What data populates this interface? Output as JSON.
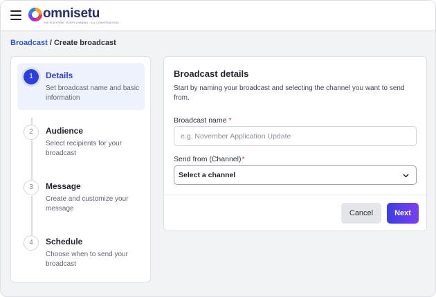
{
  "header": {
    "logo_text": "omnisetu",
    "logo_tagline": "THE PLATFORM · EVERY CHANNEL · ALL CONVERSATIONS"
  },
  "breadcrumb": {
    "parent": "Broadcast",
    "separator": " / ",
    "current": "Create broadcast"
  },
  "steps": [
    {
      "number": "1",
      "title": "Details",
      "description": "Set broadcast name and basic information",
      "active": true
    },
    {
      "number": "2",
      "title": "Audience",
      "description": "Select recipients for your broadcast",
      "active": false
    },
    {
      "number": "3",
      "title": "Message",
      "description": "Create and customize your message",
      "active": false
    },
    {
      "number": "4",
      "title": "Schedule",
      "description": "Choose when to send your broadcast",
      "active": false
    }
  ],
  "form": {
    "title": "Broadcast details",
    "subtitle": "Start by naming your broadcast and selecting the channel you want to send from.",
    "name_label": "Broadcast name",
    "name_required": "*",
    "name_value": "",
    "name_placeholder": "e.g. November Application Update",
    "channel_label": "Send from (Channel)",
    "channel_required": "*",
    "channel_selected": "Select a channel"
  },
  "actions": {
    "cancel_label": "Cancel",
    "next_label": "Next"
  },
  "colors": {
    "accent": "#2d3fd8",
    "link": "#2d55d6",
    "required": "#e03545"
  },
  "icons": {
    "menu": "hamburger-menu-icon",
    "select_arrow": "chevron-down-icon"
  }
}
